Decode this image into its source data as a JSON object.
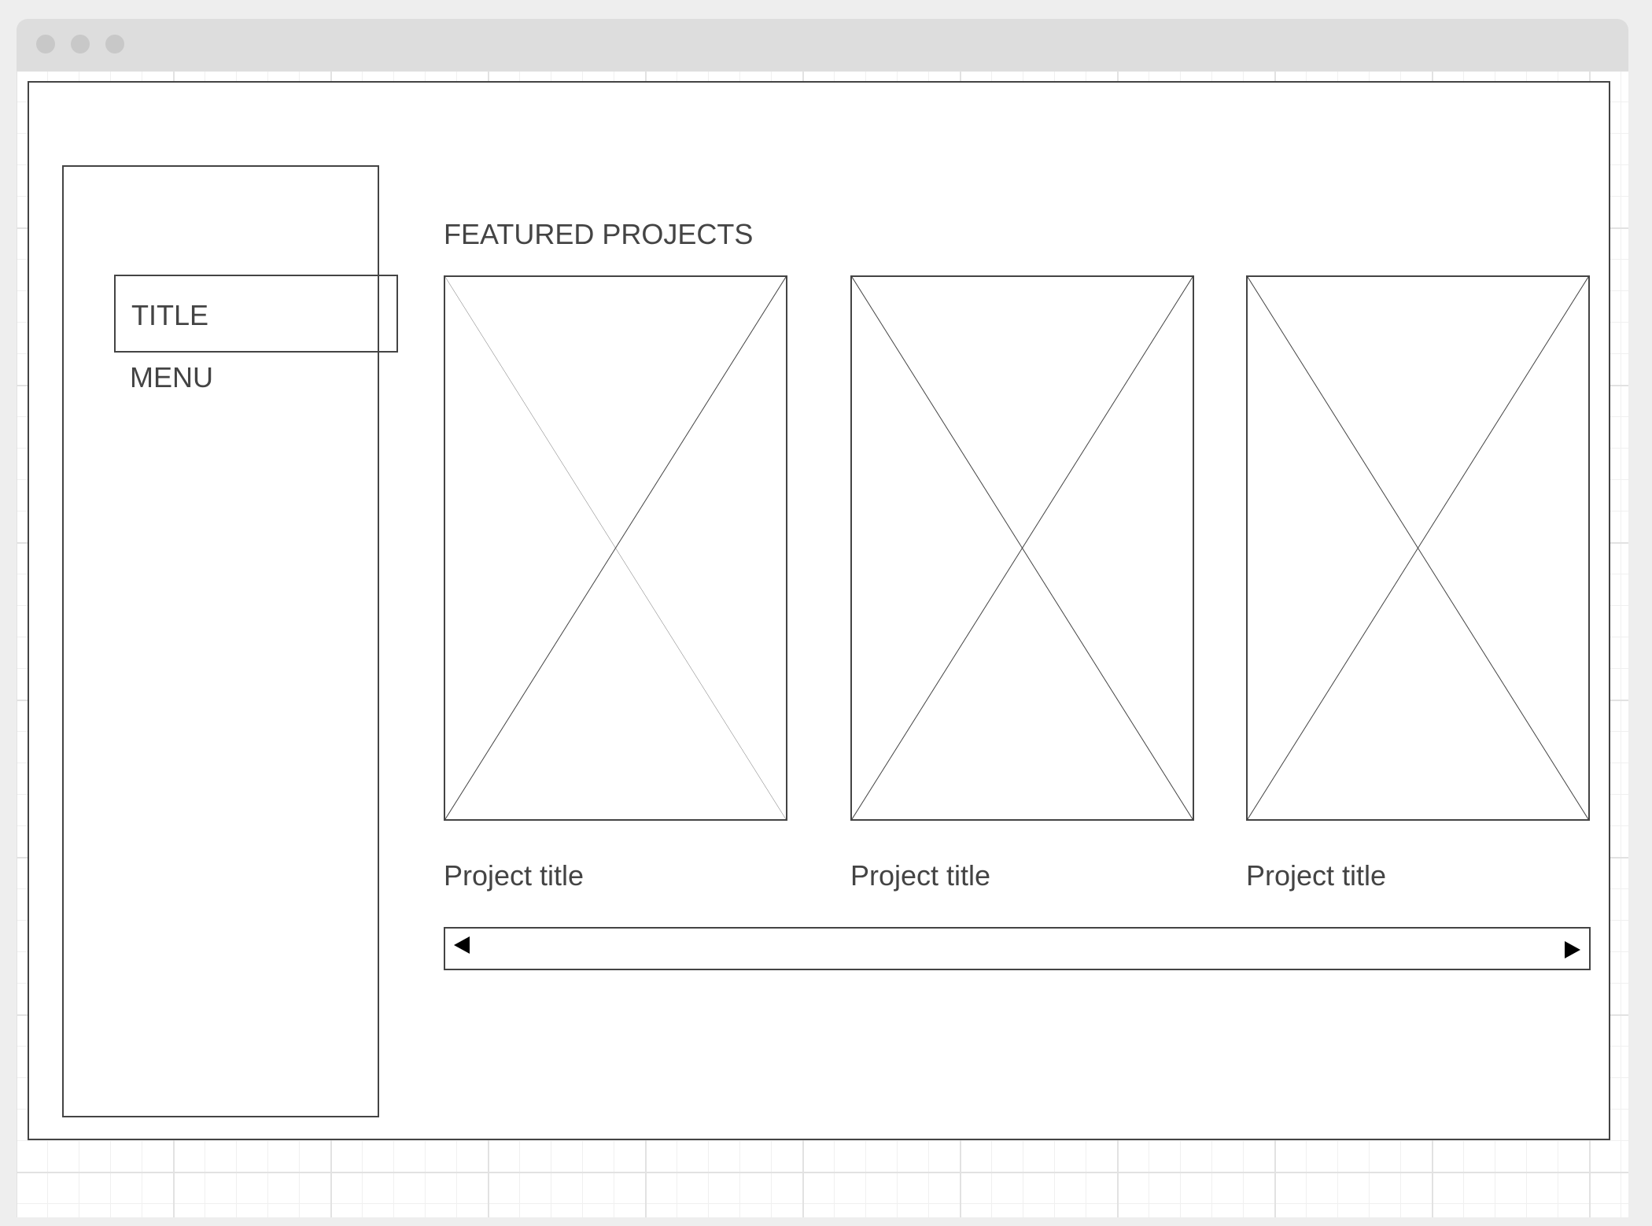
{
  "sidebar": {
    "title": "TITLE",
    "menu": "MENU"
  },
  "main": {
    "heading": "FEATURED PROJECTS",
    "projects": [
      {
        "title": "Project title"
      },
      {
        "title": "Project title"
      },
      {
        "title": "Project title"
      }
    ]
  },
  "carousel": {
    "prev_icon": "triangle-left",
    "next_icon": "triangle-right"
  }
}
